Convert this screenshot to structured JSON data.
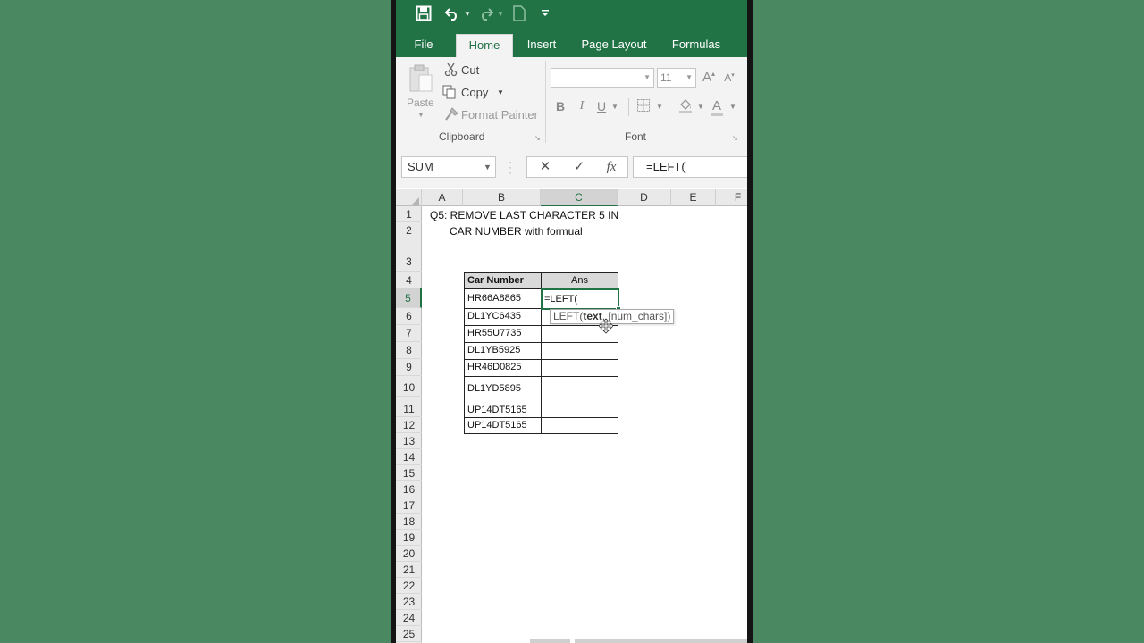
{
  "colors": {
    "excel_green": "#217346",
    "background": "#4a8862"
  },
  "quick_access": {
    "icons": [
      "save-icon",
      "undo-icon",
      "redo-icon",
      "new-file-icon",
      "customize-icon"
    ]
  },
  "tabs": [
    {
      "label": "File"
    },
    {
      "label": "Home"
    },
    {
      "label": "Insert"
    },
    {
      "label": "Page Layout"
    },
    {
      "label": "Formulas"
    }
  ],
  "active_tab": "Home",
  "ribbon": {
    "clipboard": {
      "paste": "Paste",
      "cut": "Cut",
      "copy": "Copy",
      "format_painter": "Format Painter",
      "label": "Clipboard"
    },
    "font": {
      "font_name": "",
      "font_size": "11",
      "bold": "B",
      "italic": "I",
      "underline": "U",
      "grow": "A",
      "shrink": "A",
      "font_color": "A",
      "label": "Font"
    }
  },
  "formula_bar": {
    "name_box": "SUM",
    "cancel": "✕",
    "enter": "✓",
    "fx": "fx",
    "formula": "=LEFT("
  },
  "columns": [
    "A",
    "B",
    "C",
    "D",
    "E",
    "F"
  ],
  "rows": [
    "1",
    "2",
    "3",
    "4",
    "5",
    "6",
    "7",
    "8",
    "9",
    "10",
    "11",
    "12",
    "13",
    "14",
    "15",
    "16",
    "17",
    "18",
    "19",
    "20",
    "21",
    "22",
    "23",
    "24",
    "25"
  ],
  "sheet": {
    "title_line1": "Q5: REMOVE LAST CHARACTER 5 IN",
    "title_line2": "CAR NUMBER with formual",
    "table_headers": [
      "Car Number",
      "Ans"
    ],
    "car_numbers": [
      "HR66A8865",
      "DL1YC6435",
      "HR55U7735",
      "DL1YB5925",
      "HR46D0825",
      "DL1YD5895",
      "UP14DT5165",
      "UP14DT5165"
    ],
    "active_cell_value": "=LEFT(",
    "tooltip_func": "LEFT(",
    "tooltip_arg1": "text",
    "tooltip_rest": ", [num_chars])"
  }
}
